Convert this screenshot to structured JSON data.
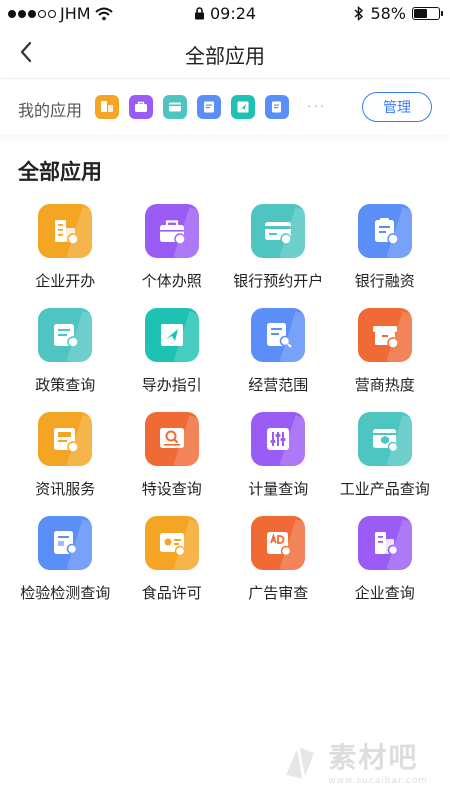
{
  "status_bar": {
    "carrier": "JHM",
    "time": "09:24",
    "battery": "58%",
    "battery_level": 0.58
  },
  "nav": {
    "title": "全部应用",
    "back_icon": "chevron-left-icon"
  },
  "my_apps": {
    "label": "我的应用",
    "more": "···",
    "manage_label": "管理",
    "icons": [
      {
        "icon": "building-doc-icon",
        "color": "#f5a524"
      },
      {
        "icon": "briefcase-icon",
        "color": "#9b5cf6"
      },
      {
        "icon": "bank-card-icon",
        "color": "#4ec5c1"
      },
      {
        "icon": "clipboard-yen-icon",
        "color": "#5b8ef7"
      },
      {
        "icon": "paper-plane-icon",
        "color": "#1fc2b2"
      },
      {
        "icon": "doc-search-icon",
        "color": "#5b8ef7"
      }
    ]
  },
  "section": {
    "title": "全部应用"
  },
  "apps": [
    {
      "label": "企业开办",
      "icon": "building-icon",
      "color": "#f5a524"
    },
    {
      "label": "个体办照",
      "icon": "briefcase-icon",
      "color": "#9b5cf6"
    },
    {
      "label": "银行预约开户",
      "icon": "bank-card-icon",
      "color": "#4ec5c1"
    },
    {
      "label": "银行融资",
      "icon": "clipboard-yen-icon",
      "color": "#5b8ef7"
    },
    {
      "label": "政策查询",
      "icon": "policy-doc-icon",
      "color": "#4ec5c1"
    },
    {
      "label": "导办指引",
      "icon": "guide-book-icon",
      "color": "#1fc2b2"
    },
    {
      "label": "经营范围",
      "icon": "doc-search-icon",
      "color": "#5b8ef7"
    },
    {
      "label": "营商热度",
      "icon": "shop-fire-icon",
      "color": "#f06a35"
    },
    {
      "label": "资讯服务",
      "icon": "news-icon",
      "color": "#f5a524"
    },
    {
      "label": "特设查询",
      "icon": "search-card-icon",
      "color": "#f06a35"
    },
    {
      "label": "计量查询",
      "icon": "sliders-icon",
      "color": "#9b5cf6"
    },
    {
      "label": "工业产品查询",
      "icon": "product-box-icon",
      "color": "#4ec5c1"
    },
    {
      "label": "检验检测查询",
      "icon": "inspection-doc-icon",
      "color": "#5b8ef7"
    },
    {
      "label": "食品许可",
      "icon": "food-license-icon",
      "color": "#f5a524"
    },
    {
      "label": "广告审查",
      "icon": "ad-review-icon",
      "color": "#f06a35"
    },
    {
      "label": "企业查询",
      "icon": "building-search-icon",
      "color": "#9b5cf6"
    }
  ],
  "watermark": {
    "text": "素材吧",
    "url": "www.sucaibar.com"
  }
}
